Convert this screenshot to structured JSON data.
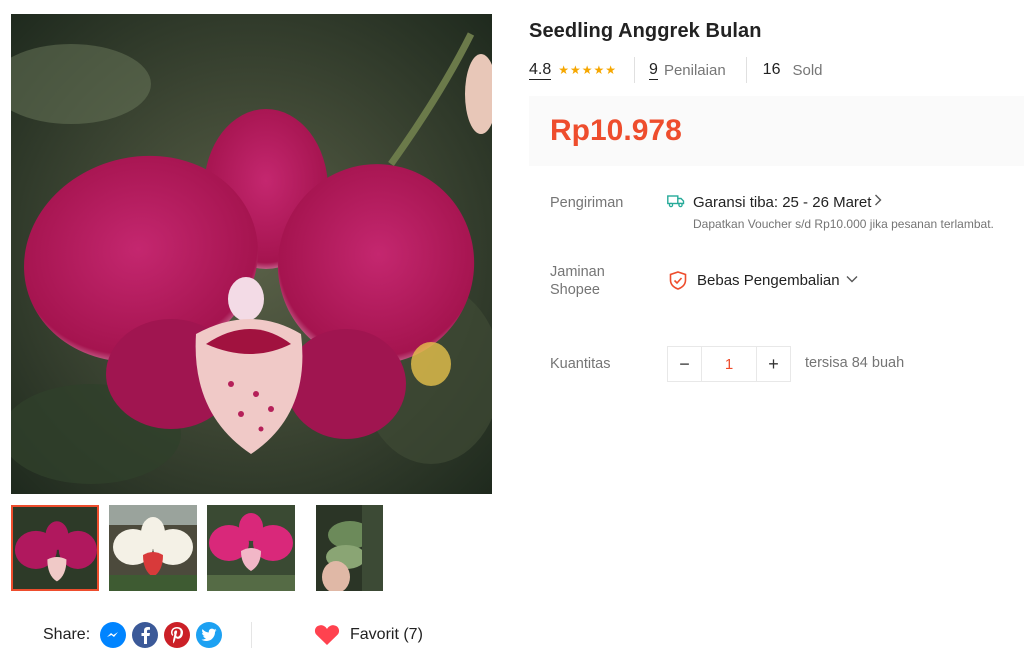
{
  "product": {
    "title": "Seedling Anggrek Bulan",
    "rating": "4.8",
    "stars": "★★★★★",
    "reviews_count": "9",
    "reviews_label": "Penilaian",
    "sold_count": "16",
    "sold_label": "Sold",
    "price": "Rp10.978"
  },
  "shipping": {
    "label": "Pengiriman",
    "guarantee": "Garansi tiba: 25 - 26 Maret",
    "voucher_note": "Dapatkan Voucher s/d Rp10.000 jika pesanan terlambat."
  },
  "guarantee": {
    "label_line1": "Jaminan",
    "label_line2": "Shopee",
    "value": "Bebas Pengembalian"
  },
  "quantity": {
    "label": "Kuantitas",
    "value": "1",
    "minus": "−",
    "plus": "+",
    "stock": "tersisa 84 buah"
  },
  "share": {
    "label": "Share:",
    "icons": [
      "messenger-icon",
      "facebook-icon",
      "pinterest-icon",
      "twitter-icon"
    ]
  },
  "favorite": {
    "label": "Favorit (7)"
  },
  "colors": {
    "accent": "#ee4d2d",
    "star": "#f6a700",
    "orchid_magenta": "#b0185e",
    "messenger": "#0084ff",
    "facebook": "#3b5998",
    "pinterest": "#cb2027",
    "twitter": "#1da1f2",
    "heart": "#ff424f"
  }
}
